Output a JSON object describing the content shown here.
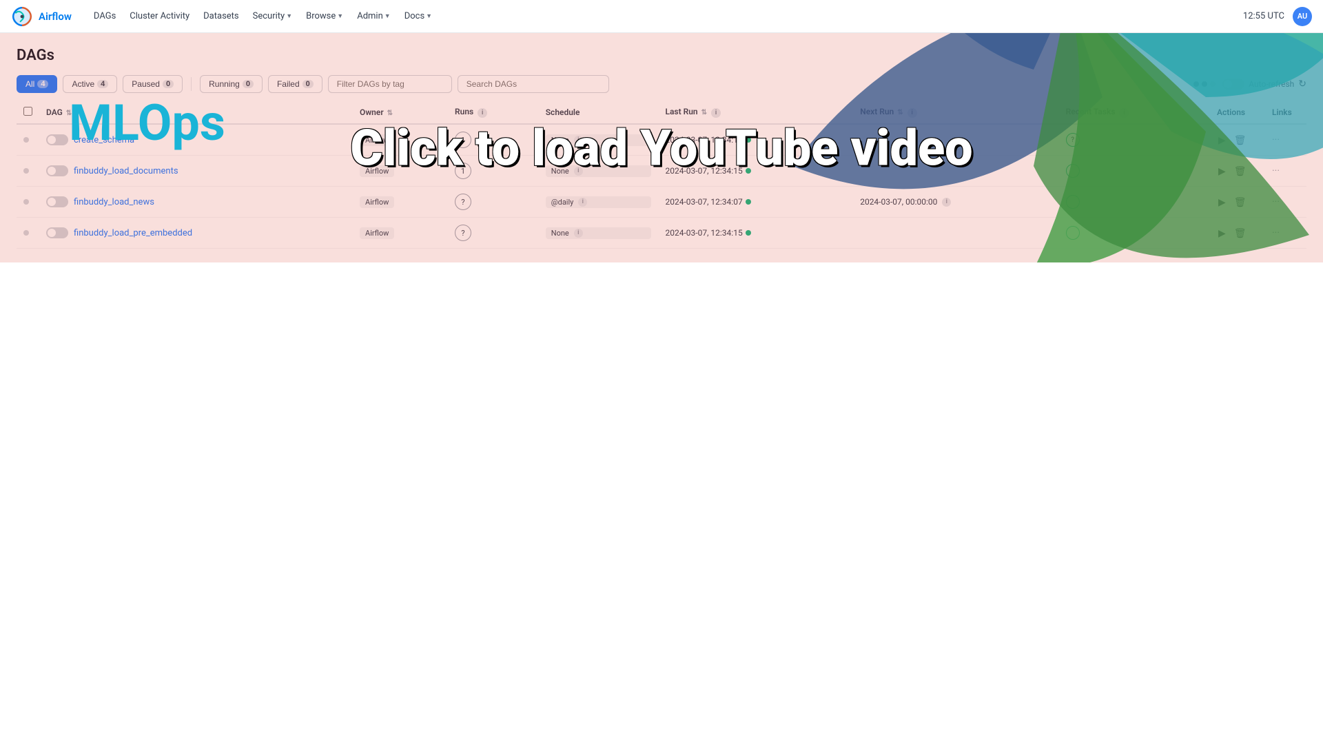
{
  "navbar": {
    "logo_text": "Airflow",
    "nav_items": [
      {
        "label": "DAGs",
        "has_caret": false
      },
      {
        "label": "Cluster Activity",
        "has_caret": false
      },
      {
        "label": "Datasets",
        "has_caret": false
      },
      {
        "label": "Security",
        "has_caret": true
      },
      {
        "label": "Browse",
        "has_caret": true
      },
      {
        "label": "Admin",
        "has_caret": true
      },
      {
        "label": "Docs",
        "has_caret": true
      }
    ],
    "time": "12:55 UTC",
    "avatar": "AU"
  },
  "page": {
    "title": "DAGs"
  },
  "filters": {
    "all_label": "All",
    "all_count": "4",
    "active_label": "Active",
    "active_count": "4",
    "paused_label": "Paused",
    "paused_count": "0",
    "running_label": "Running",
    "running_count": "0",
    "failed_label": "Failed",
    "failed_count": "0",
    "tag_placeholder": "Filter DAGs by tag",
    "search_placeholder": "Search DAGs",
    "auto_refresh_label": "Auto-refresh"
  },
  "table": {
    "headers": {
      "dag": "DAG",
      "owner": "Owner",
      "runs": "Runs",
      "schedule": "Schedule",
      "last_run": "Last Run",
      "next_run": "Next Run",
      "recent_tasks": "Recent Tasks",
      "actions": "Actions",
      "links": "Links"
    },
    "rows": [
      {
        "name": "create_schema",
        "owner": "Airflow",
        "runs": "1",
        "schedule": "None",
        "last_run": "2024-03-07, 12:34:14",
        "next_run": "",
        "recent_tasks_count": "?",
        "paused": false
      },
      {
        "name": "finbuddy_load_documents",
        "owner": "Airflow",
        "runs": "1",
        "schedule": "None",
        "last_run": "2024-03-07, 12:34:15",
        "next_run": "",
        "recent_tasks_count": "",
        "paused": false
      },
      {
        "name": "finbuddy_load_news",
        "owner": "Airflow",
        "runs": "?",
        "schedule": "@daily",
        "last_run": "2024-03-07, 12:34:07",
        "next_run": "2024-03-07, 00:00:00",
        "recent_tasks_count": "",
        "paused": false
      },
      {
        "name": "finbuddy_load_pre_embedded",
        "owner": "Airflow",
        "runs": "?",
        "schedule": "None",
        "last_run": "2024-03-07, 12:34:15",
        "next_run": "",
        "recent_tasks_count": "",
        "paused": false
      }
    ]
  },
  "overlay": {
    "click_text": "Click to load YouTube video",
    "mlops_text": "MLOps"
  }
}
